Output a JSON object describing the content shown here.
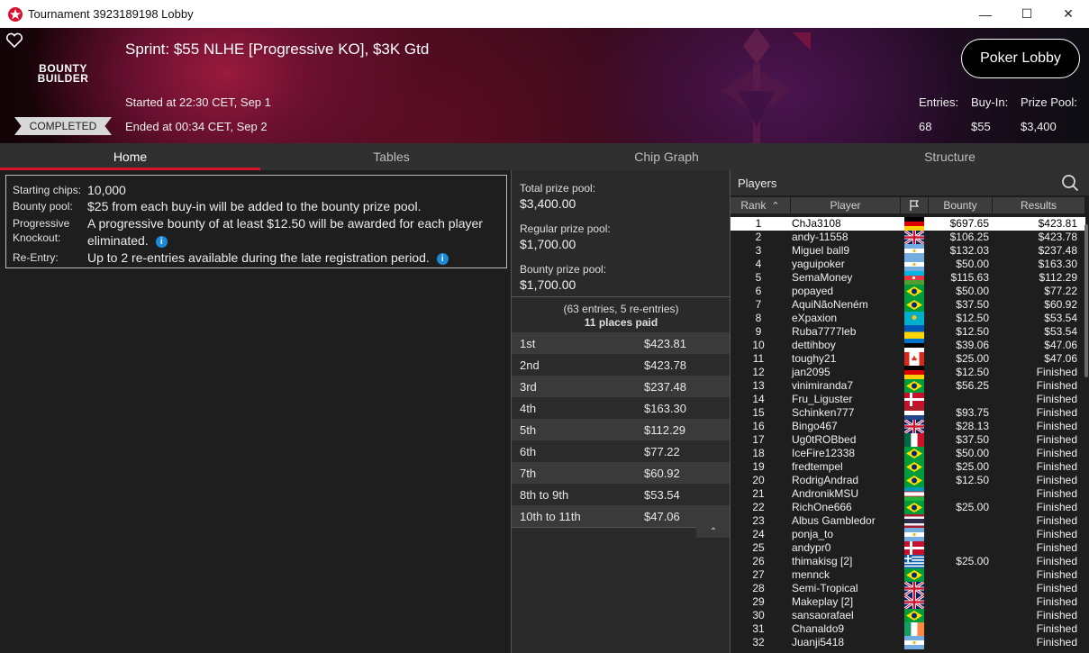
{
  "window": {
    "title": "Tournament 3923189198 Lobby",
    "minimize": "—",
    "maximize": "☐",
    "close": "✕"
  },
  "header": {
    "logo_line1": "BOUNTY",
    "logo_line2": "BUILDER",
    "name": "Sprint: $55 NLHE [Progressive KO], $3K Gtd",
    "started": "Started at 22:30 CET, Sep 1",
    "ended": "Ended at 00:34 CET, Sep 2",
    "status": "COMPLETED",
    "lobby_button": "Poker Lobby",
    "entries_label": "Entries:",
    "entries": "68",
    "buyin_label": "Buy-In:",
    "buyin": "$55",
    "prizepool_label": "Prize Pool:",
    "prizepool": "$3,400"
  },
  "tabs": [
    {
      "label": "Home"
    },
    {
      "label": "Tables"
    },
    {
      "label": "Chip Graph"
    },
    {
      "label": "Structure"
    }
  ],
  "info": {
    "starting_chips_label": "Starting chips:",
    "starting_chips": "10,000",
    "bounty_pool_label": "Bounty pool:",
    "bounty_pool": "$25 from each buy-in will be added to the bounty prize pool.",
    "pko_label1": "Progressive",
    "pko_label2": "Knockout:",
    "pko": "A progressive bounty of at least $12.50 will be awarded for each player eliminated.",
    "reentry_label": "Re-Entry:",
    "reentry": "Up to 2 re-entries available during the late registration period."
  },
  "prizes": {
    "total_label": "Total prize pool:",
    "total": "$3,400.00",
    "regular_label": "Regular prize pool:",
    "regular": "$1,700.00",
    "bounty_label": "Bounty prize pool:",
    "bounty": "$1,700.00",
    "entries_note": "(63 entries, 5 re-entries)",
    "places_paid": "11 places paid",
    "payouts": [
      {
        "place": "1st",
        "amount": "$423.81"
      },
      {
        "place": "2nd",
        "amount": "$423.78"
      },
      {
        "place": "3rd",
        "amount": "$237.48"
      },
      {
        "place": "4th",
        "amount": "$163.30"
      },
      {
        "place": "5th",
        "amount": "$112.29"
      },
      {
        "place": "6th",
        "amount": "$77.22"
      },
      {
        "place": "7th",
        "amount": "$60.92"
      },
      {
        "place": "8th to 9th",
        "amount": "$53.54"
      },
      {
        "place": "10th to 11th",
        "amount": "$47.06"
      }
    ]
  },
  "players": {
    "title": "Players",
    "columns": {
      "rank": "Rank",
      "player": "Player",
      "bounty": "Bounty",
      "results": "Results"
    },
    "rows": [
      {
        "rank": "1",
        "name": "ChJa3108",
        "flag": "de",
        "bounty": "$697.65",
        "result": "$423.81"
      },
      {
        "rank": "2",
        "name": "andy-11558",
        "flag": "gb",
        "bounty": "$106.25",
        "result": "$423.78"
      },
      {
        "rank": "3",
        "name": "Miguel ball9",
        "flag": "ar",
        "bounty": "$132.03",
        "result": "$237.48"
      },
      {
        "rank": "4",
        "name": "yaguipoker",
        "flag": "ar",
        "bounty": "$50.00",
        "result": "$163.30"
      },
      {
        "rank": "5",
        "name": "SemaMoney",
        "flag": "az",
        "bounty": "$115.63",
        "result": "$112.29"
      },
      {
        "rank": "6",
        "name": "popayed",
        "flag": "br",
        "bounty": "$50.00",
        "result": "$77.22"
      },
      {
        "rank": "7",
        "name": "AquiNãoNeném",
        "flag": "br",
        "bounty": "$37.50",
        "result": "$60.92"
      },
      {
        "rank": "8",
        "name": "eXpaxion",
        "flag": "kz",
        "bounty": "$12.50",
        "result": "$53.54"
      },
      {
        "rank": "9",
        "name": "Ruba7777leb",
        "flag": "ua",
        "bounty": "$12.50",
        "result": "$53.54"
      },
      {
        "rank": "10",
        "name": "dettihboy",
        "flag": "ee",
        "bounty": "$39.06",
        "result": "$47.06"
      },
      {
        "rank": "11",
        "name": "toughy21",
        "flag": "ca",
        "bounty": "$25.00",
        "result": "$47.06"
      },
      {
        "rank": "12",
        "name": "jan2095",
        "flag": "de",
        "bounty": "$12.50",
        "result": "Finished"
      },
      {
        "rank": "13",
        "name": "vinimiranda7",
        "flag": "br",
        "bounty": "$56.25",
        "result": "Finished"
      },
      {
        "rank": "14",
        "name": "Fru_Liguster",
        "flag": "dk",
        "bounty": "",
        "result": "Finished"
      },
      {
        "rank": "15",
        "name": "Schinken777",
        "flag": "nl",
        "bounty": "$93.75",
        "result": "Finished"
      },
      {
        "rank": "16",
        "name": "Bingo467",
        "flag": "gb",
        "bounty": "$28.13",
        "result": "Finished"
      },
      {
        "rank": "17",
        "name": "Ug0tROBbed",
        "flag": "mx",
        "bounty": "$37.50",
        "result": "Finished"
      },
      {
        "rank": "18",
        "name": "IceFire12338",
        "flag": "br",
        "bounty": "$50.00",
        "result": "Finished"
      },
      {
        "rank": "19",
        "name": "fredtempel",
        "flag": "br",
        "bounty": "$25.00",
        "result": "Finished"
      },
      {
        "rank": "20",
        "name": "RodrigAndrad",
        "flag": "br",
        "bounty": "$12.50",
        "result": "Finished"
      },
      {
        "rank": "21",
        "name": "AndronikMSU",
        "flag": "uz",
        "bounty": "",
        "result": "Finished"
      },
      {
        "rank": "22",
        "name": "RichOne666",
        "flag": "br",
        "bounty": "$25.00",
        "result": "Finished"
      },
      {
        "rank": "23",
        "name": "Albus Gambledor",
        "flag": "th",
        "bounty": "",
        "result": "Finished"
      },
      {
        "rank": "24",
        "name": "ponja_to",
        "flag": "ar",
        "bounty": "",
        "result": "Finished"
      },
      {
        "rank": "25",
        "name": "andypr0",
        "flag": "dk",
        "bounty": "",
        "result": "Finished"
      },
      {
        "rank": "26",
        "name": "thimakisg [2]",
        "flag": "gr",
        "bounty": "$25.00",
        "result": "Finished"
      },
      {
        "rank": "27",
        "name": "mennck",
        "flag": "br",
        "bounty": "",
        "result": "Finished"
      },
      {
        "rank": "28",
        "name": "Semi-Tropical",
        "flag": "gb",
        "bounty": "",
        "result": "Finished"
      },
      {
        "rank": "29",
        "name": "Makeplay [2]",
        "flag": "gb",
        "bounty": "",
        "result": "Finished"
      },
      {
        "rank": "30",
        "name": "sansaorafael",
        "flag": "br",
        "bounty": "",
        "result": "Finished"
      },
      {
        "rank": "31",
        "name": "Chanaldo9",
        "flag": "ie",
        "bounty": "",
        "result": "Finished"
      },
      {
        "rank": "32",
        "name": "Juanji5418",
        "flag": "ar",
        "bounty": "",
        "result": "Finished"
      }
    ]
  },
  "colors": {
    "accent": "#d8122e",
    "info": "#1a8ad8"
  }
}
